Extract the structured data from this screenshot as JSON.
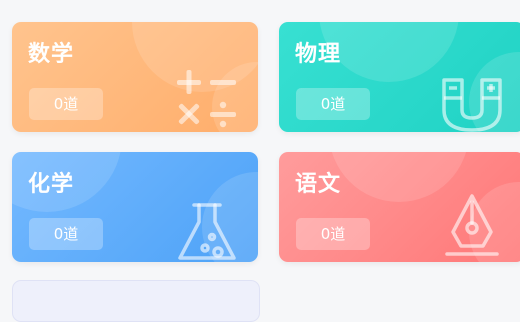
{
  "cards": [
    {
      "title": "数学",
      "count": "0道",
      "color": "#ffb47a",
      "icon": "math-operators-icon"
    },
    {
      "title": "物理",
      "count": "0道",
      "color": "#26d8c8",
      "icon": "magnet-icon"
    },
    {
      "title": "化学",
      "count": "0道",
      "color": "#5aaaf9",
      "icon": "flask-icon"
    },
    {
      "title": "语文",
      "count": "0道",
      "color": "#ff8080",
      "icon": "pen-nib-icon"
    }
  ]
}
